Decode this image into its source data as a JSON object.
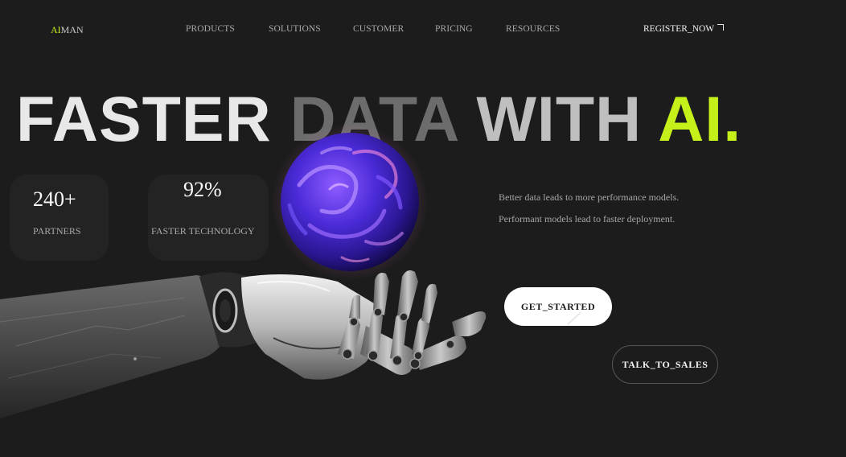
{
  "nav": {
    "logo_accent": "AI",
    "logo_rest": "MAN",
    "items": [
      "PRODUCTS",
      "SOLUTIONS",
      "CUSTOMER",
      "PRICING",
      "RESOURCES"
    ],
    "register": "REGISTER_NOW"
  },
  "hero": {
    "headline_1": "FASTER",
    "headline_2": "DATA",
    "headline_3": "WITH",
    "headline_4": "AI."
  },
  "stats": [
    {
      "value": "240+",
      "label": "PARTNERS"
    },
    {
      "value": "92%",
      "label": "FASTER TECHNOLOGY"
    }
  ],
  "description": "Better data leads to more performance models. Performant models lead to faster deployment.",
  "buttons": {
    "get_started": "GET_STARTED",
    "talk_to_sales": "TALK_TO_SALES"
  },
  "colors": {
    "background": "#1c1c1c",
    "accent": "#c6f01a",
    "card": "#232323",
    "orb": "#4b2bd8"
  }
}
